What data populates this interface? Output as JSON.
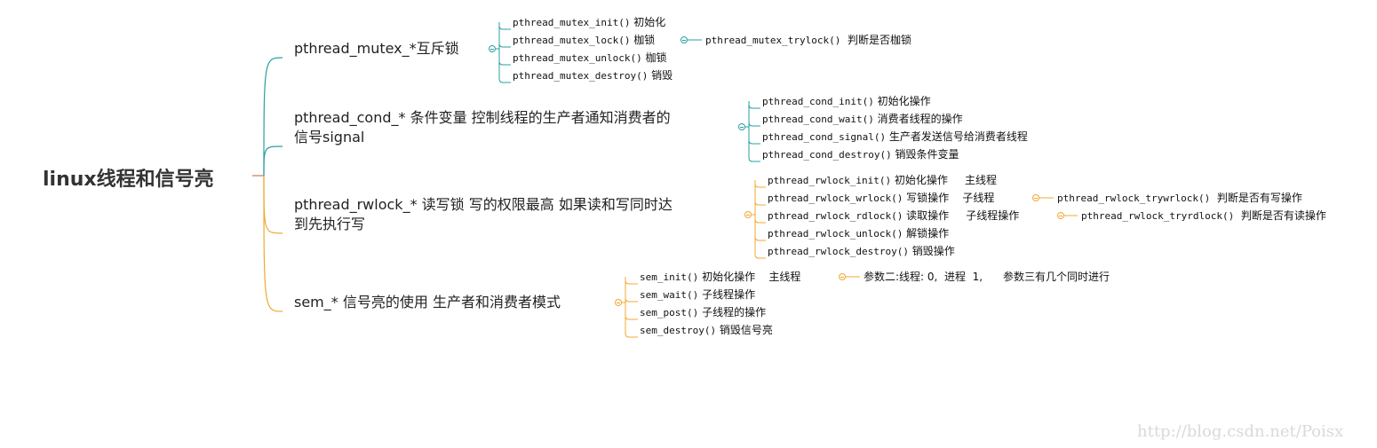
{
  "root": {
    "label": "linux线程和信号亮"
  },
  "branches": [
    {
      "label": "pthread_mutex_*互斥锁",
      "color": "#2a9fa0",
      "children": [
        {
          "fn": "pthread_mutex_init()",
          "note": "初始化"
        },
        {
          "fn": "pthread_mutex_lock()",
          "note": "枷锁",
          "sub": {
            "fn": "pthread_mutex_trylock()",
            "note": "判断是否枷锁"
          }
        },
        {
          "fn": "pthread_mutex_unlock()",
          "note": "枷锁"
        },
        {
          "fn": "pthread_mutex_destroy()",
          "note": "销毁"
        }
      ]
    },
    {
      "label": "pthread_cond_* 条件变量  控制线程的生产者通知消费者的",
      "label2": "信号signal",
      "color": "#2a9fa0",
      "children": [
        {
          "fn": "pthread_cond_init()",
          "note": "初始化操作"
        },
        {
          "fn": "pthread_cond_wait()",
          "note": "消费者线程的操作"
        },
        {
          "fn": "pthread_cond_signal()",
          "note": "生产者发送信号给消费者线程"
        },
        {
          "fn": "pthread_cond_destroy()",
          "note": "销毁条件变量"
        }
      ]
    },
    {
      "label": "pthread_rwlock_* 读写锁   写的权限最高 如果读和写同时达",
      "label2": "到先执行写",
      "color": "#f0a830",
      "children": [
        {
          "fn": "pthread_rwlock_init()",
          "note": "初始化操作     主线程"
        },
        {
          "fn": "pthread_rwlock_wrlock()",
          "note": "写锁操作    子线程",
          "sub": {
            "fn": "pthread_rwlock_trywrlock()",
            "note": "判断是否有写操作"
          }
        },
        {
          "fn": "pthread_rwlock_rdlock()",
          "note": "读取操作     子线程操作",
          "sub": {
            "fn": "pthread_rwlock_tryrdlock()",
            "note": "判断是否有读操作"
          }
        },
        {
          "fn": "pthread_rwlock_unlock()",
          "note": "解锁操作"
        },
        {
          "fn": "pthread_rwlock_destroy()",
          "note": "销毁操作"
        }
      ]
    },
    {
      "label": "sem_* 信号亮的使用  生产者和消费者模式",
      "color": "#f0a830",
      "children": [
        {
          "fn": "sem_init()",
          "note": "初始化操作    主线程",
          "sub": {
            "fn": "",
            "note": "参数二:线程: 0,  进程  1,      参数三有几个同时进行"
          }
        },
        {
          "fn": "sem_wait()",
          "note": "子线程操作"
        },
        {
          "fn": "sem_post()",
          "note": "子线程的操作"
        },
        {
          "fn": "sem_destroy()",
          "note": "销毁信号亮"
        }
      ]
    }
  ],
  "watermark": "http://blog.csdn.net/Poisx"
}
